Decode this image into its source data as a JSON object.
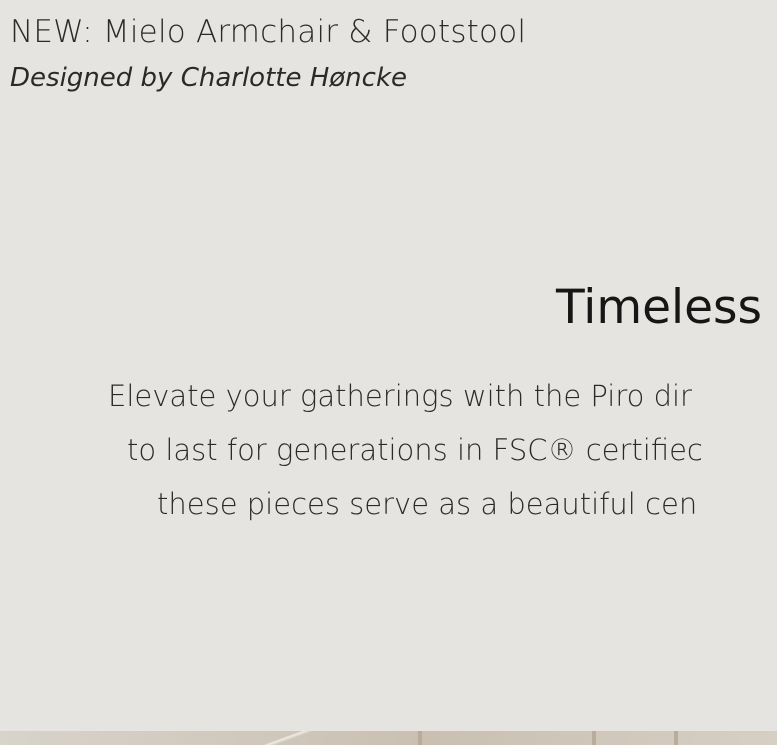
{
  "promo": {
    "title": "NEW: Mielo Armchair & Footstool",
    "designer": "Designed by Charlotte Høncke"
  },
  "section": {
    "heading": "Timeless",
    "body_lines": [
      "Elevate your gatherings with the Piro dir",
      "to last for generations in FSC® certifiec",
      "these pieces serve as a beautiful cen"
    ]
  },
  "colors": {
    "background": "#e6e4e0",
    "text": "#1c1c1c"
  }
}
